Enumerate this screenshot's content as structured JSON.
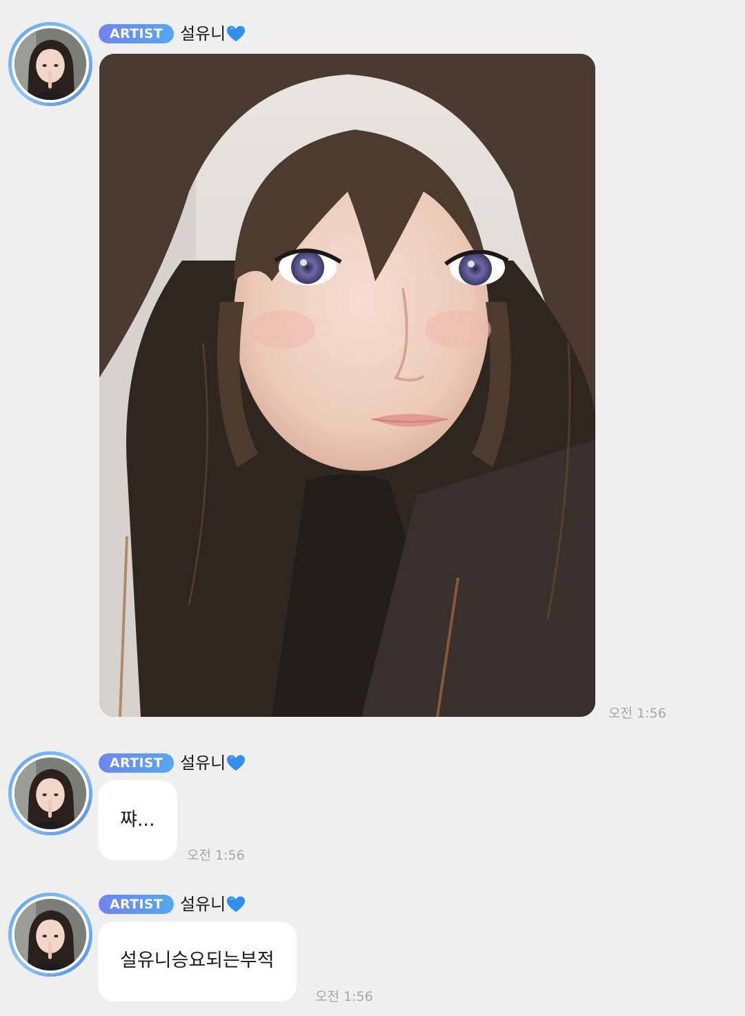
{
  "messages": [
    {
      "badge": "ARTIST",
      "sender": "설유니",
      "heart_icon": "blue-heart-icon",
      "type": "photo",
      "photo_icon": "selfie-photo",
      "time": "오전 1:56"
    },
    {
      "badge": "ARTIST",
      "sender": "설유니",
      "heart_icon": "blue-heart-icon",
      "type": "text",
      "text": "쨔...",
      "time": "오전 1:56"
    },
    {
      "badge": "ARTIST",
      "sender": "설유니",
      "heart_icon": "blue-heart-icon",
      "type": "text",
      "text": "설유니승요되는부적",
      "time": "오전 1:56"
    }
  ],
  "colors": {
    "background": "#efefef",
    "badge_gradient_start": "#6f84f2",
    "badge_gradient_end": "#54a8f0",
    "avatar_ring": "#5aa0f0",
    "heart": "#2f8ff0",
    "bubble": "#ffffff",
    "timestamp": "#a6a6a6"
  }
}
